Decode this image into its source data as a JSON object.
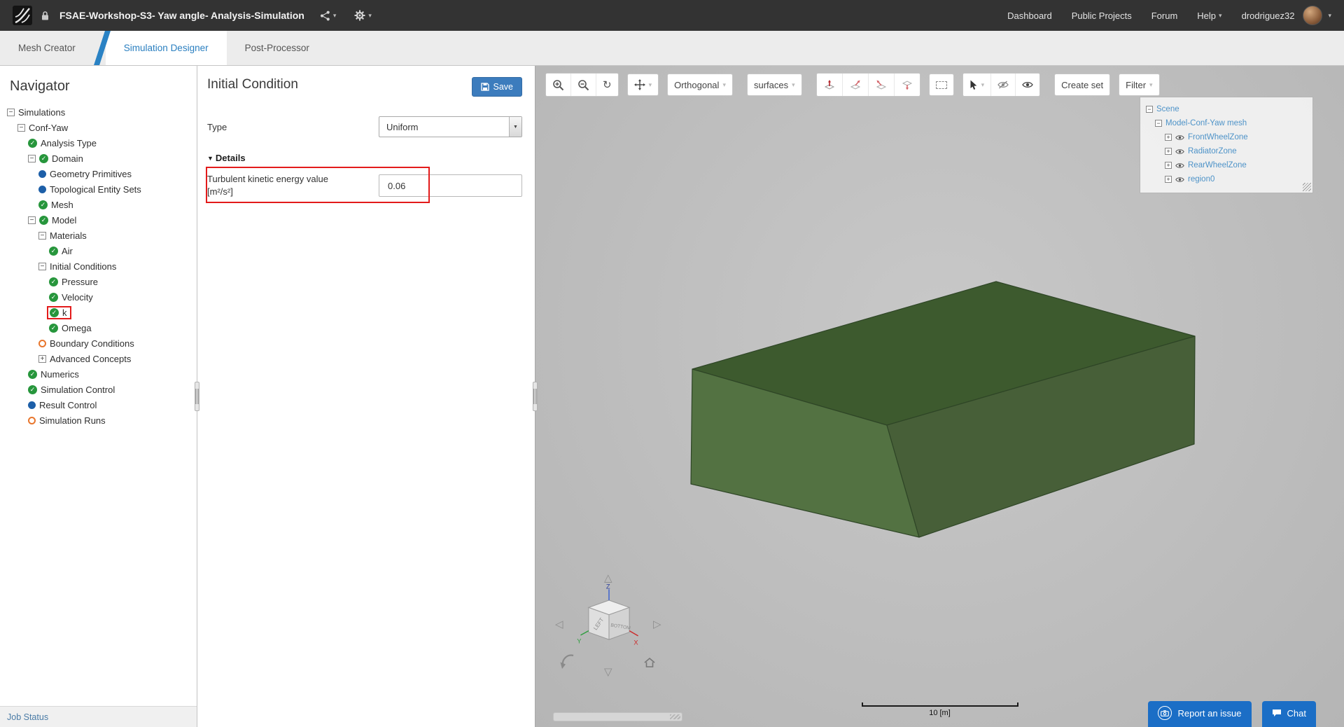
{
  "topbar": {
    "title": "FSAE-Workshop-S3- Yaw angle- Analysis-Simulation",
    "links": [
      "Dashboard",
      "Public Projects",
      "Forum",
      "Help"
    ],
    "username": "drodriguez32"
  },
  "tabs": [
    {
      "label": "Mesh Creator"
    },
    {
      "label": "Simulation Designer"
    },
    {
      "label": "Post-Processor"
    }
  ],
  "navigator": {
    "title": "Navigator",
    "job_status": "Job Status",
    "tree": [
      {
        "label": "Simulations",
        "depth": 0,
        "icon": "none",
        "expand": "minus"
      },
      {
        "label": "Conf-Yaw",
        "depth": 1,
        "icon": "none",
        "expand": "minus"
      },
      {
        "label": "Analysis Type",
        "depth": 2,
        "icon": "check"
      },
      {
        "label": "Domain",
        "depth": 2,
        "icon": "check",
        "expand": "minus"
      },
      {
        "label": "Geometry Primitives",
        "depth": 3,
        "icon": "dot"
      },
      {
        "label": "Topological Entity Sets",
        "depth": 3,
        "icon": "dot"
      },
      {
        "label": "Mesh",
        "depth": 3,
        "icon": "check"
      },
      {
        "label": "Model",
        "depth": 2,
        "icon": "check",
        "expand": "minus"
      },
      {
        "label": "Materials",
        "depth": 3,
        "icon": "none",
        "expand": "minus"
      },
      {
        "label": "Air",
        "depth": 4,
        "icon": "check"
      },
      {
        "label": "Initial Conditions",
        "depth": 3,
        "icon": "none",
        "expand": "minus"
      },
      {
        "label": "Pressure",
        "depth": 4,
        "icon": "check"
      },
      {
        "label": "Velocity",
        "depth": 4,
        "icon": "check"
      },
      {
        "label": "k",
        "depth": 4,
        "icon": "check",
        "selected": true
      },
      {
        "label": "Omega",
        "depth": 4,
        "icon": "check"
      },
      {
        "label": "Boundary Conditions",
        "depth": 3,
        "icon": "circle"
      },
      {
        "label": "Advanced Concepts",
        "depth": 3,
        "icon": "none",
        "expand": "plus"
      },
      {
        "label": "Numerics",
        "depth": 2,
        "icon": "check"
      },
      {
        "label": "Simulation Control",
        "depth": 2,
        "icon": "check"
      },
      {
        "label": "Result Control",
        "depth": 2,
        "icon": "dot"
      },
      {
        "label": "Simulation Runs",
        "depth": 2,
        "icon": "circle"
      }
    ]
  },
  "panel": {
    "title": "Initial Condition",
    "save_label": "Save",
    "type_label": "Type",
    "type_value": "Uniform",
    "details_label": "Details",
    "field": {
      "label_line1": "Turbulent kinetic energy value",
      "label_line2": "[m²/s²]",
      "value": "0.06"
    }
  },
  "viewport": {
    "toolbar": {
      "projection_label": "Orthogonal",
      "render_mode_label": "surfaces",
      "create_set_label": "Create set",
      "filter_label": "Filter"
    },
    "scene_tree": {
      "root_label": "Scene",
      "mesh_label": "Model-Conf-Yaw mesh",
      "children": [
        "FrontWheelZone",
        "RadiatorZone",
        "RearWheelZone",
        "region0"
      ]
    },
    "mesh_colors": {
      "top": "#3d5a2e",
      "left": "#537242",
      "right": "#475f38"
    },
    "gizmo": {
      "left_label": "LEFT",
      "bottom_label": "BOTTOM",
      "x_label": "X",
      "y_label": "Y",
      "z_label": "Z"
    },
    "scale_label": "10 [m]",
    "report_button": "Report an issue",
    "chat_button": "Chat"
  },
  "icons": {
    "chevron": "▾",
    "refresh": "↻",
    "select_arrow": "▼",
    "details_arrow": "▼",
    "check": "✓",
    "collapse": "−",
    "expand": "+",
    "tri_up": "△",
    "tri_down": "▽",
    "tri_left": "◁",
    "tri_right": "▷"
  },
  "colors": {
    "accent_blue": "#2a7fc0",
    "button_blue": "#1b6ec6",
    "status_green": "#27963c",
    "status_blue": "#1d5fa8",
    "status_orange": "#e8762d",
    "highlight_red": "#e31b1b"
  }
}
